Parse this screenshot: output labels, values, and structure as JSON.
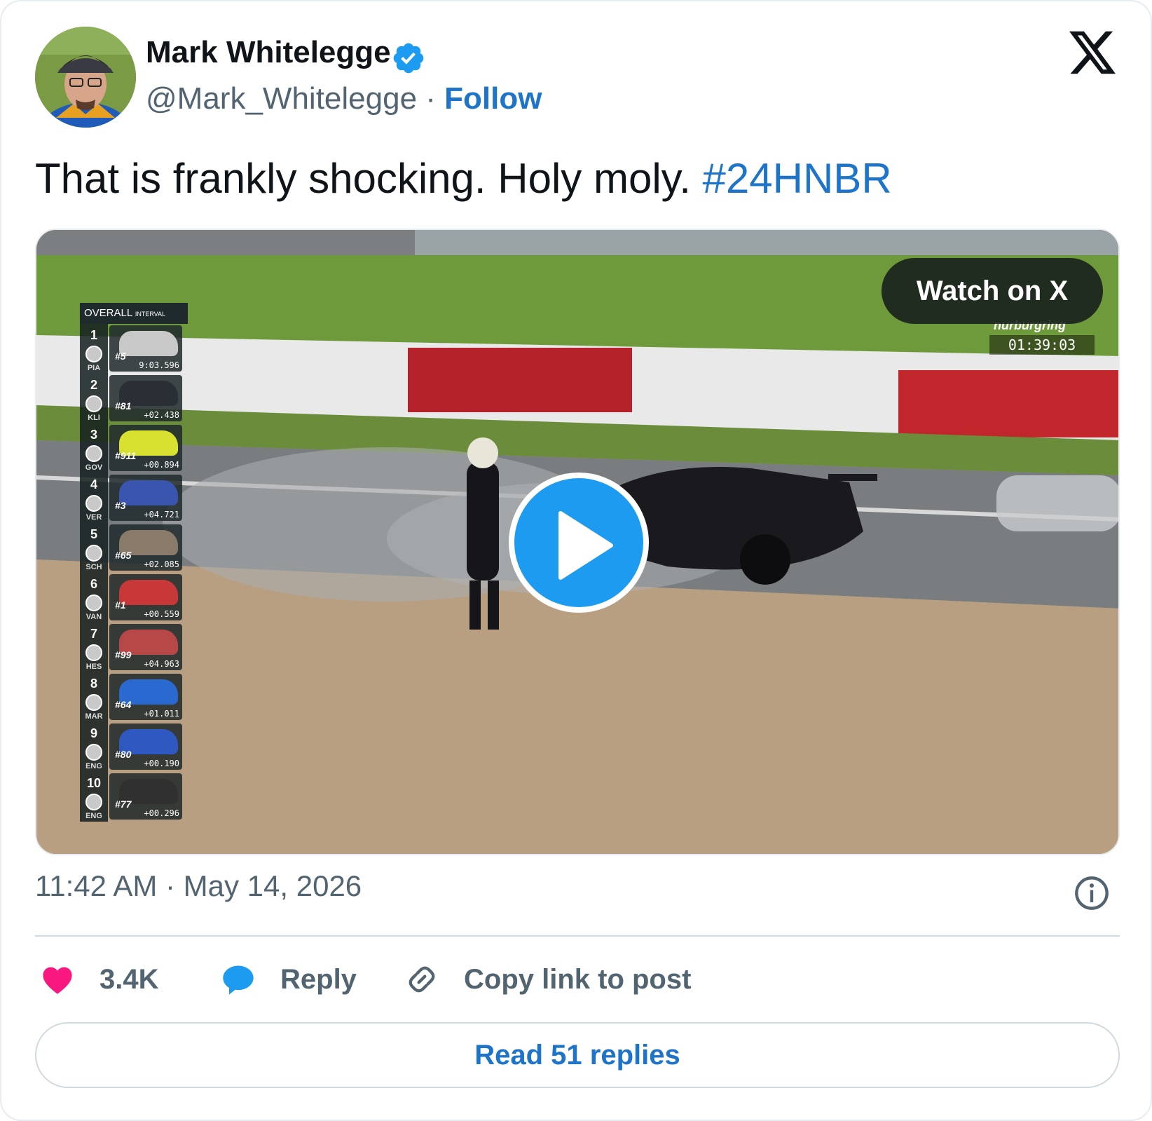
{
  "author": {
    "name": "Mark Whitelegge",
    "handle": "@Mark_Whitelegge",
    "separator": "·",
    "follow_label": "Follow",
    "verified_color": "#1d9bf0"
  },
  "tweet": {
    "text": "That is frankly shocking. Holy moly. ",
    "hashtag": "#24HNBR",
    "timestamp": "11:42 AM · May 14, 2026"
  },
  "media": {
    "watch_label": "Watch on X",
    "overlay_location": "nurburgring",
    "overlay_clock": "01:39:03",
    "leaderboard": {
      "title": "OVERALL",
      "subtitle": "INTERVAL",
      "rows": [
        {
          "pos": "1",
          "abbr": "PIA",
          "car": "#5",
          "gap": "9:03.596",
          "color": "#c8c8c8"
        },
        {
          "pos": "2",
          "abbr": "KLI",
          "car": "#81",
          "gap": "+02.438",
          "color": "#2a2f35"
        },
        {
          "pos": "3",
          "abbr": "GOV",
          "car": "#911",
          "gap": "+00.894",
          "color": "#d8e030"
        },
        {
          "pos": "4",
          "abbr": "VER",
          "car": "#3",
          "gap": "+04.721",
          "color": "#3a55b0"
        },
        {
          "pos": "5",
          "abbr": "SCH",
          "car": "#65",
          "gap": "+02.085",
          "color": "#8a7a6a"
        },
        {
          "pos": "6",
          "abbr": "VAN",
          "car": "#1",
          "gap": "+00.559",
          "color": "#c83838"
        },
        {
          "pos": "7",
          "abbr": "HES",
          "car": "#99",
          "gap": "+04.963",
          "color": "#b84848"
        },
        {
          "pos": "8",
          "abbr": "MAR",
          "car": "#64",
          "gap": "+01.011",
          "color": "#2a6ad0"
        },
        {
          "pos": "9",
          "abbr": "ENG",
          "car": "#80",
          "gap": "+00.190",
          "color": "#2f58c0"
        },
        {
          "pos": "10",
          "abbr": "ENG",
          "car": "#77",
          "gap": "+00.296",
          "color": "#303030"
        }
      ]
    }
  },
  "actions": {
    "like_count": "3.4K",
    "reply_label": "Reply",
    "copy_label": "Copy link to post",
    "read_replies_label": "Read 51 replies"
  },
  "colors": {
    "link": "#1d74c9",
    "like": "#f91880",
    "reply": "#1d9bf0"
  }
}
